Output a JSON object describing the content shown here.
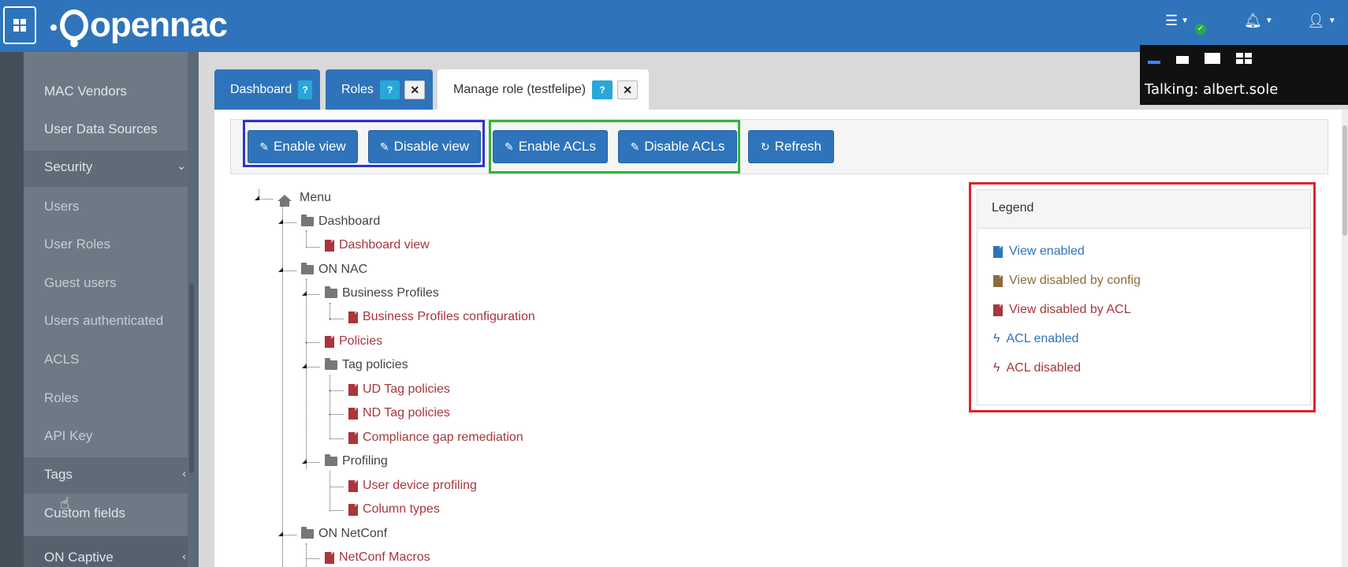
{
  "header": {
    "logo_text": "opennac",
    "apps_icon": "grid-icon",
    "server_icon": "server-icon",
    "bell_icon": "bell-icon",
    "user_icon": "user-icon"
  },
  "talking": {
    "label": "Talking: albert.sole"
  },
  "sidebar": {
    "items": [
      {
        "label": "MAC Vendors"
      },
      {
        "label": "User Data Sources"
      },
      {
        "label": "Security"
      },
      {
        "label": "Users"
      },
      {
        "label": "User Roles"
      },
      {
        "label": "Guest users"
      },
      {
        "label": "Users authenticated"
      },
      {
        "label": "ACLS"
      },
      {
        "label": "Roles"
      },
      {
        "label": "API Key"
      },
      {
        "label": "Tags"
      },
      {
        "label": "Custom fields"
      },
      {
        "label": "ON Captive"
      }
    ]
  },
  "tabs": [
    {
      "label": "Dashboard",
      "badge": "?"
    },
    {
      "label": "Roles",
      "badge": "?",
      "close": "✕"
    },
    {
      "label": "Manage role (testfelipe)",
      "badge": "?",
      "close": "✕"
    }
  ],
  "toolbar": {
    "enable_view": "Enable view",
    "disable_view": "Disable view",
    "enable_acls": "Enable ACLs",
    "disable_acls": "Disable ACLs",
    "refresh": "Refresh"
  },
  "tree": {
    "menu": "Menu",
    "dashboard": "Dashboard",
    "dashboard_view": "Dashboard view",
    "on_nac": "ON NAC",
    "business_profiles": "Business Profiles",
    "business_profiles_configuration": "Business Profiles configuration",
    "policies": "Policies",
    "tag_policies": "Tag policies",
    "ud_tag_policies": "UD Tag policies",
    "nd_tag_policies": "ND Tag policies",
    "compliance_gap_remediation": "Compliance gap remediation",
    "profiling": "Profiling",
    "user_device_profiling": "User device profiling",
    "column_types": "Column types",
    "on_netconf": "ON NetConf",
    "netconf_macros": "NetConf Macros"
  },
  "legend": {
    "title": "Legend",
    "items": [
      {
        "label": "View enabled",
        "color": "#2f74ba"
      },
      {
        "label": "View disabled by config",
        "color": "#8a6d3b"
      },
      {
        "label": "View disabled by ACL",
        "color": "#a8363c"
      },
      {
        "label": "ACL enabled",
        "color": "#2f74ba"
      },
      {
        "label": "ACL disabled",
        "color": "#a8363c"
      }
    ]
  }
}
